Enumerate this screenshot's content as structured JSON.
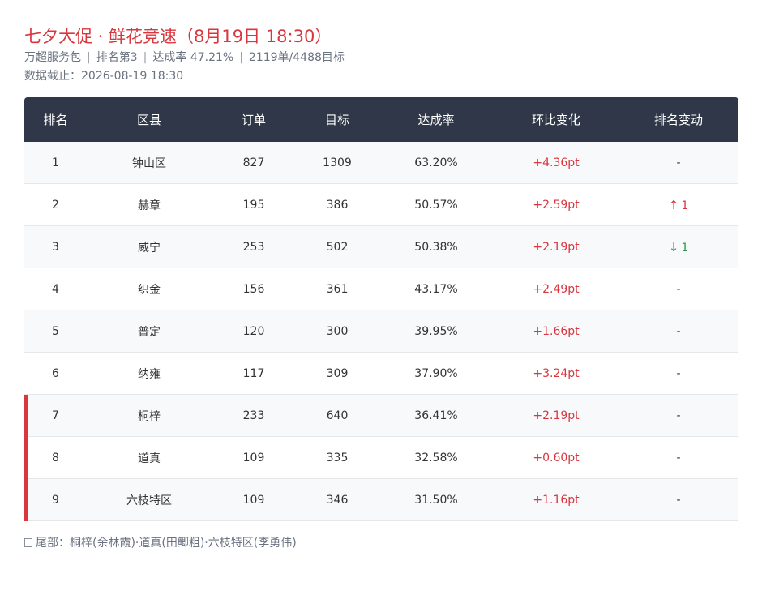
{
  "header": {
    "title": "七夕大促 · 鲜花竞速（8月19日 18:30）",
    "subtitle": {
      "package": "万超服务包",
      "rank": "排名第3",
      "rate": "达成率 47.21%",
      "progress": "2119单/4488目标"
    },
    "timestamp": "数据截止：2026-08-19 18:30"
  },
  "table": {
    "columns": [
      "排名",
      "区县",
      "订单",
      "目标",
      "达成率",
      "环比变化",
      "排名变动"
    ],
    "rows": [
      {
        "rank": "1",
        "district": "钟山区",
        "orders": "827",
        "target": "1309",
        "rate": "63.20%",
        "change": "+4.36pt",
        "rank_change": {
          "dir": "none",
          "arrow": "",
          "value": "-"
        }
      },
      {
        "rank": "2",
        "district": "赫章",
        "orders": "195",
        "target": "386",
        "rate": "50.57%",
        "change": "+2.59pt",
        "rank_change": {
          "dir": "up",
          "arrow": "↑",
          "value": "1"
        }
      },
      {
        "rank": "3",
        "district": "威宁",
        "orders": "253",
        "target": "502",
        "rate": "50.38%",
        "change": "+2.19pt",
        "rank_change": {
          "dir": "down",
          "arrow": "↓",
          "value": "1"
        }
      },
      {
        "rank": "4",
        "district": "织金",
        "orders": "156",
        "target": "361",
        "rate": "43.17%",
        "change": "+2.49pt",
        "rank_change": {
          "dir": "none",
          "arrow": "",
          "value": "-"
        }
      },
      {
        "rank": "5",
        "district": "普定",
        "orders": "120",
        "target": "300",
        "rate": "39.95%",
        "change": "+1.66pt",
        "rank_change": {
          "dir": "none",
          "arrow": "",
          "value": "-"
        }
      },
      {
        "rank": "6",
        "district": "纳雍",
        "orders": "117",
        "target": "309",
        "rate": "37.90%",
        "change": "+3.24pt",
        "rank_change": {
          "dir": "none",
          "arrow": "",
          "value": "-"
        }
      },
      {
        "rank": "7",
        "district": "桐梓",
        "orders": "233",
        "target": "640",
        "rate": "36.41%",
        "change": "+2.19pt",
        "rank_change": {
          "dir": "none",
          "arrow": "",
          "value": "-"
        },
        "tail": true
      },
      {
        "rank": "8",
        "district": "道真",
        "orders": "109",
        "target": "335",
        "rate": "32.58%",
        "change": "+0.60pt",
        "rank_change": {
          "dir": "none",
          "arrow": "",
          "value": "-"
        },
        "tail": true
      },
      {
        "rank": "9",
        "district": "六枝特区",
        "orders": "109",
        "target": "346",
        "rate": "31.50%",
        "change": "+1.16pt",
        "rank_change": {
          "dir": "none",
          "arrow": "",
          "value": "-"
        },
        "tail": true
      }
    ]
  },
  "footer": {
    "icon": "flag-icon",
    "text": "尾部：桐梓(余林霞)·道真(田鲫粗)·六枝特区(李勇伟)"
  },
  "colors": {
    "accent": "#d9363e",
    "header_bg": "#2f3748",
    "up": "#d9363e",
    "down": "#2e9b3f"
  }
}
